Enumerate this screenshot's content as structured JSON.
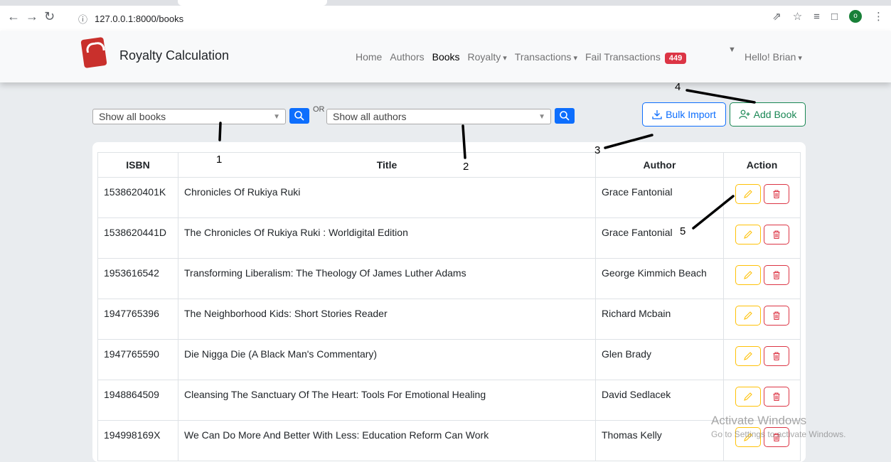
{
  "browser": {
    "url": "127.0.0.1:8000/books",
    "profile_initial": "o"
  },
  "navbar": {
    "brand": "Royalty Calculation",
    "links": [
      "Home",
      "Authors",
      "Books",
      "Royalty",
      "Transactions",
      "Fail Transactions"
    ],
    "active": "Books",
    "fail_count": "449",
    "user_menu": "Hello! Brian"
  },
  "filters": {
    "book_select": "Show all books",
    "or_label": "OR",
    "author_select": "Show all authors"
  },
  "actions": {
    "bulk_import": "Bulk Import",
    "add_book": "Add Book"
  },
  "table": {
    "headers": [
      "ISBN",
      "Title",
      "Author",
      "Action"
    ],
    "rows": [
      {
        "isbn": "1538620401K",
        "title": "Chronicles Of Rukiya Ruki",
        "author": "Grace Fantonial"
      },
      {
        "isbn": "1538620441D",
        "title": "The Chronicles Of Rukiya Ruki : Worldigital Edition",
        "author": "Grace Fantonial"
      },
      {
        "isbn": "1953616542",
        "title": "Transforming Liberalism: The Theology Of James Luther Adams",
        "author": "George Kimmich Beach"
      },
      {
        "isbn": "1947765396",
        "title": "The Neighborhood Kids: Short Stories Reader",
        "author": "Richard Mcbain"
      },
      {
        "isbn": "1947765590",
        "title": "Die Nigga Die (A Black Man's Commentary)",
        "author": "Glen Brady"
      },
      {
        "isbn": "1948864509",
        "title": "Cleansing The Sanctuary Of The Heart: Tools For Emotional Healing",
        "author": "David Sedlacek"
      },
      {
        "isbn": "194998169X",
        "title": "We Can Do More And Better With Less: Education Reform Can Work",
        "author": "Thomas Kelly"
      }
    ]
  },
  "annotations": [
    "1",
    "2",
    "3",
    "4",
    "5"
  ],
  "watermark": {
    "line1": "Activate Windows",
    "line2": "Go to Settings to activate Windows."
  },
  "colors": {
    "primary": "#0d6efd",
    "success": "#198754",
    "warning": "#ffc107",
    "danger": "#dc3545"
  }
}
